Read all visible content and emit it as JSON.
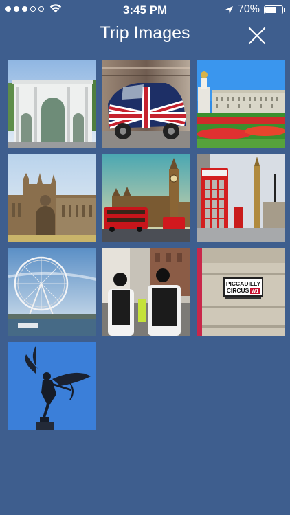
{
  "status_bar": {
    "signal_dots_filled": 3,
    "signal_dots_total": 5,
    "time": "3:45 PM",
    "battery_percent": "70%",
    "battery_level": 0.7,
    "icons": [
      "signal-dots-icon",
      "wifi-icon",
      "location-arrow-icon",
      "battery-icon"
    ]
  },
  "header": {
    "title": "Trip Images",
    "close_icon": "close-icon"
  },
  "images": [
    {
      "subject": "marble-arch"
    },
    {
      "subject": "union-jack-taxi"
    },
    {
      "subject": "buckingham-palace"
    },
    {
      "subject": "westminster-abbey"
    },
    {
      "subject": "big-ben-red-buses"
    },
    {
      "subject": "red-telephone-box"
    },
    {
      "subject": "london-eye"
    },
    {
      "subject": "police-officers"
    },
    {
      "subject": "piccadilly-circus-sign",
      "sign_line1": "PICCADILLY",
      "sign_line2": "CIRCUS",
      "sign_district": "W1"
    },
    {
      "subject": "eros-statue"
    }
  ],
  "colors": {
    "background": "#3e5e8e",
    "text": "#ffffff"
  }
}
